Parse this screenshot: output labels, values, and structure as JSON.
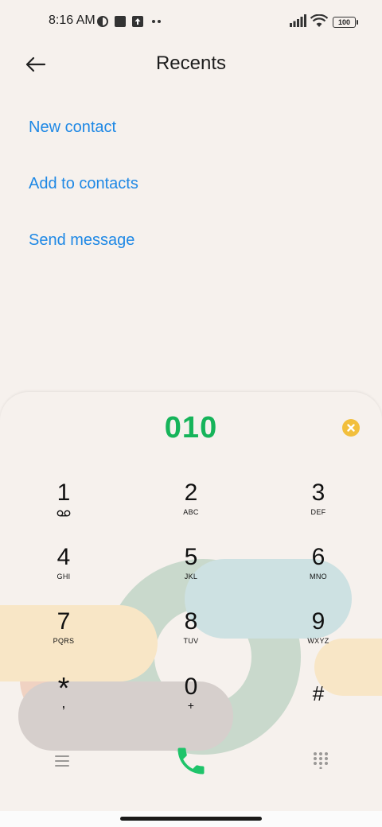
{
  "status_bar": {
    "time": "8:16 AM",
    "battery": "100"
  },
  "header": {
    "title": "Recents"
  },
  "actions": [
    {
      "label": "New contact"
    },
    {
      "label": "Add to contacts"
    },
    {
      "label": "Send message"
    }
  ],
  "dialer": {
    "number": "010",
    "keys": [
      {
        "digit": "1",
        "letters": ""
      },
      {
        "digit": "2",
        "letters": "ABC"
      },
      {
        "digit": "3",
        "letters": "DEF"
      },
      {
        "digit": "4",
        "letters": "GHI"
      },
      {
        "digit": "5",
        "letters": "JKL"
      },
      {
        "digit": "6",
        "letters": "MNO"
      },
      {
        "digit": "7",
        "letters": "PQRS"
      },
      {
        "digit": "8",
        "letters": "TUV"
      },
      {
        "digit": "9",
        "letters": "WXYZ"
      },
      {
        "digit": "*",
        "letters": ","
      },
      {
        "digit": "0",
        "letters": "+"
      },
      {
        "digit": "#",
        "letters": ""
      }
    ]
  },
  "colors": {
    "accent_blue": "#1e88e5",
    "number_green": "#16b45a",
    "call_green": "#1fc46a",
    "clear_yellow": "#f2bf3c",
    "background": "#f6f1ed"
  },
  "icons": {
    "voicemail": "voicemail-icon",
    "menu": "menu-icon",
    "call": "phone-icon",
    "keypad": "dialpad-icon",
    "back": "arrow-left-icon",
    "clear": "close-circle-icon"
  }
}
